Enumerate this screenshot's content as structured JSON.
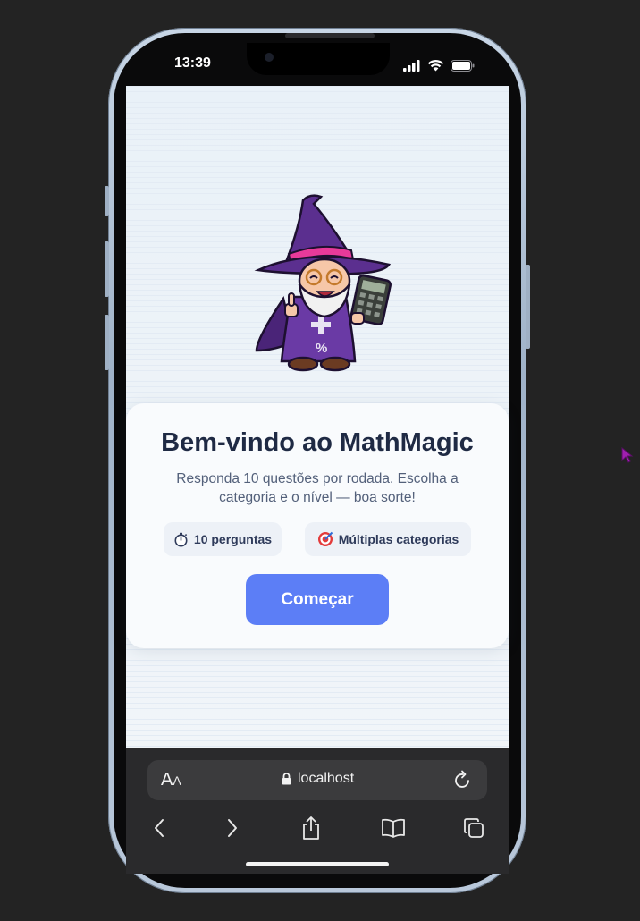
{
  "status_bar": {
    "time": "13:39"
  },
  "welcome": {
    "title": "Bem-vindo ao MathMagic",
    "subtitle": "Responda 10 questões por rodada. Escolha a categoria e o nível — boa sorte!",
    "chips": [
      {
        "icon": "stopwatch-icon",
        "label": "10 perguntas"
      },
      {
        "icon": "target-icon",
        "label": "Múltiplas categorias"
      }
    ],
    "start_button": "Começar"
  },
  "browser": {
    "text_size_label": "AA",
    "url": "localhost"
  },
  "colors": {
    "accent": "#5c7ef6",
    "title": "#1f2a44",
    "wizard_hat": "#5b2f8f",
    "hat_band": "#e83a9a"
  }
}
